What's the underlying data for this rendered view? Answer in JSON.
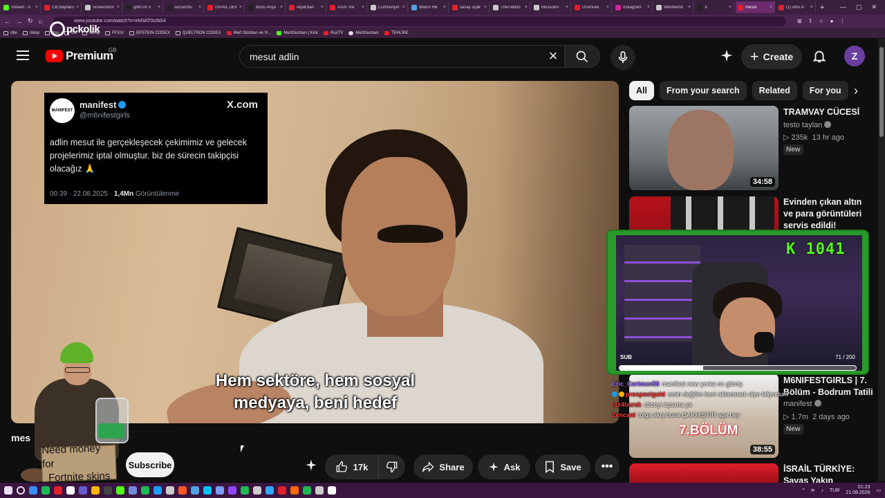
{
  "browser": {
    "tabs": [
      {
        "label": "Stream - K",
        "color": "#53fc18"
      },
      {
        "label": "CB Baydars",
        "color": "#e0202b"
      },
      {
        "label": "Screenshot",
        "color": "#c9c9c9"
      },
      {
        "label": "gdfn on X",
        "color": "#222222"
      },
      {
        "label": "soccer/bu",
        "color": "#222222"
      },
      {
        "label": "İSRAİL DEN",
        "color": "#e0202b"
      },
      {
        "label": "Bunu Anya",
        "color": "#222222"
      },
      {
        "label": "Alparslan",
        "color": "#e0202b"
      },
      {
        "label": "Asım Tok",
        "color": "#e0202b"
      },
      {
        "label": "Cumhuriyet",
        "color": "#c9c9c9"
      },
      {
        "label": "Watch HB",
        "color": "#4fa3e0"
      },
      {
        "label": "savaş uçak",
        "color": "#e0202b"
      },
      {
        "label": "TheFabloo",
        "color": "#c9c9c9"
      },
      {
        "label": "Mussolini",
        "color": "#c9c9c9"
      },
      {
        "label": "Örümcek",
        "color": "#e0202b"
      },
      {
        "label": "Instagram",
        "color": "#d6249f"
      },
      {
        "label": "Westworld",
        "color": "#c9c9c9"
      },
      {
        "label": "X",
        "color": "#222222"
      },
      {
        "label": "mesut",
        "color": "#e0202b"
      },
      {
        "label": "(1) who is",
        "color": "#e0202b"
      }
    ],
    "active_tab_index": 18,
    "new_tab_label": "+",
    "address": "www.youtube.com/watch?v=eM3AT0o5tS4",
    "bookmarks": [
      {
        "label": "/die",
        "icon": "folder-icon"
      },
      {
        "label": "/skop",
        "icon": "folder-icon"
      },
      {
        "label": "/mu",
        "icon": "folder-icon"
      },
      {
        "label": "/tio",
        "icon": "folder-icon"
      },
      {
        "label": "/temp",
        "icon": "folder-icon"
      },
      {
        "label": "FFXIV",
        "icon": "folder-icon"
      },
      {
        "label": "EPSTEIN CODEX",
        "icon": "folder-icon"
      },
      {
        "label": "QUELTRON CODEX",
        "icon": "folder-icon"
      },
      {
        "label": "Mert Günhan ve Yi...",
        "icon": "youtube-icon"
      },
      {
        "label": "MertGunhan | Kick",
        "icon": "kick-icon"
      },
      {
        "label": "RusTV",
        "icon": "youtube-icon"
      },
      {
        "label": "MertGunhan",
        "icon": "github-icon"
      },
      {
        "label": "TEHLİKE",
        "icon": "youtube-icon"
      }
    ]
  },
  "stream_brand": {
    "text": "pckolik"
  },
  "youtube": {
    "brand": "Premium",
    "region": "GB",
    "search_value": "mesut adlin",
    "create_label": "Create",
    "avatar_letter": "Z",
    "chips": [
      "All",
      "From your search",
      "Related",
      "For you"
    ],
    "video": {
      "title_partial": "mes",
      "subtitle_line1": "Hem sektöre, hem sosyal",
      "subtitle_line2": "medyaya, beni hedef",
      "tweet": {
        "name": "manifest",
        "handle": "@m6nifestgirls",
        "brand": "X.com",
        "avatar_text": "MANIFEST",
        "body": "adlin mesut ile gerçekleşecek çekimimiz ve gelecek projelerimiz iptal olmuştur. biz de sürecin takipçisi olacağız 🙏",
        "time": "00:39 · 22.08.2025 · ",
        "views": "1,4Mn",
        "views_suffix": " Görüntülenme"
      }
    },
    "actions": {
      "subscribe": "Subscribe",
      "likes": "17k",
      "share": "Share",
      "ask": "Ask",
      "save": "Save",
      "more": "•••"
    },
    "recommendations": [
      {
        "title": "TRAMVAY CÜCESİ",
        "channel": "testo taylan",
        "views": "235k",
        "age": "13 hr ago",
        "badge": "New",
        "duration": "34:58"
      },
      {
        "title": "Evinden çıkan altın ve para görüntüleri servis edildi! Alparslan ...",
        "channel": "",
        "views": "",
        "age": "",
        "badge": "",
        "duration": ""
      },
      {
        "title": "M6NIFESTGIRLS | 7. Bölüm - Bodrum Tatili",
        "channel": "manifest",
        "views": "1.7m",
        "age": "2 days ago",
        "badge": "New",
        "duration": "38:55",
        "thumb_text": "7.BÖLÜM"
      },
      {
        "title": "İSRAİL TÜRKİYE: Savaş Yakın",
        "channel": "",
        "views": "",
        "age": "",
        "badge": "",
        "duration": ""
      }
    ]
  },
  "stream_overlay": {
    "kick_counter": "K 1041",
    "sub_label": "SUB",
    "sub_count": "71 / 200",
    "sub_progress": 0.355,
    "beggar_sign_line1": "Need money for",
    "beggar_sign_line2": "Fortnite skins",
    "chat": [
      {
        "user": "Eric_Cartman58",
        "color": "#9b6cff",
        "badge": "",
        "text": "manifest new yorka mı gitmiş"
      },
      {
        "user": "prospectgold",
        "color": "#ff3b3b",
        "badge": "blue gold",
        "text": "emin değilim beni aklanmadı diye biliyodum"
      },
      {
        "user": "r1z4burak",
        "color": "#ff3b3b",
        "badge": "",
        "text": "cüceyi açsana ya"
      },
      {
        "user": "Zencani",
        "color": "#ff3b3b",
        "badge": "",
        "text": "tolga akış buna ÇAKMIŞTIR aga bey"
      }
    ]
  },
  "taskbar": {
    "language": "TUR",
    "time": "01:23",
    "date": "21.08.2026",
    "apps": [
      "#3d8bfd",
      "#1db954",
      "#e0202b",
      "#ffffff",
      "#6a5acd",
      "#ffb400",
      "#444444",
      "#53fc18",
      "#7289da",
      "#1db954",
      "#1a9fff",
      "#cccccc",
      "#ff5722",
      "#4fa3e0",
      "#00c2ff",
      "#7aa0ff",
      "#9146ff",
      "#1db954",
      "#cccccc",
      "#31a8ff",
      "#e0202b",
      "#ff6a00",
      "#1db954",
      "#cccccc",
      "#ffffff"
    ]
  }
}
